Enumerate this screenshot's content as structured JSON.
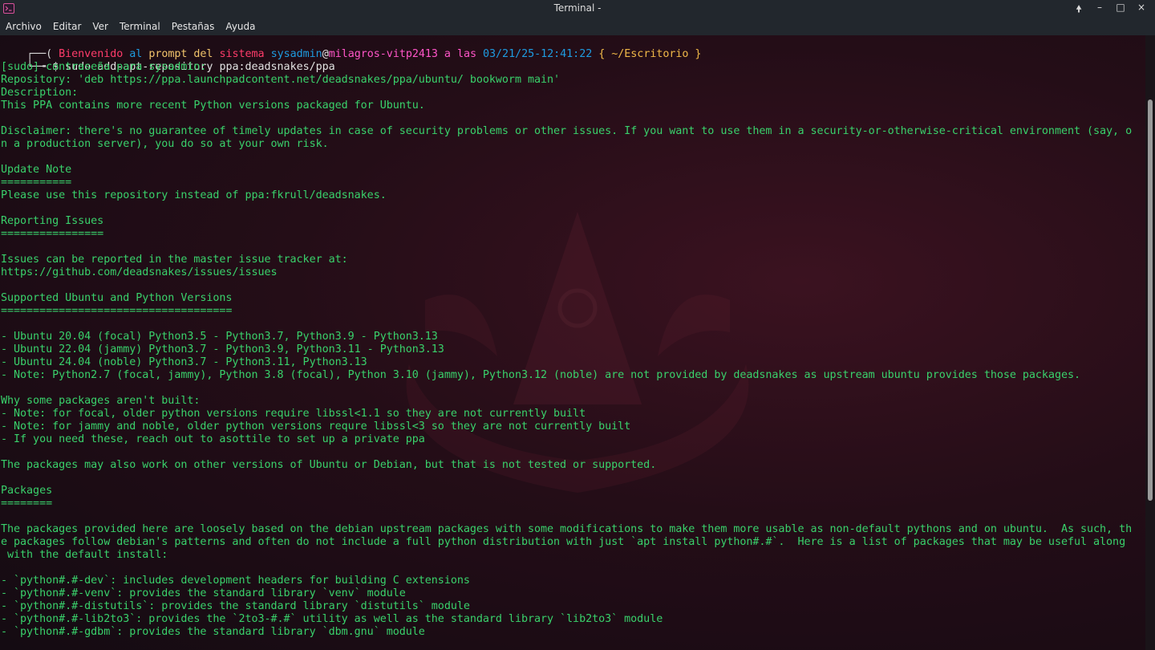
{
  "window": {
    "title": "Terminal -",
    "icon": "terminal-icon",
    "controls": {
      "keep_above": "🠝",
      "minimize": "–",
      "maximize": "□",
      "close": "×"
    }
  },
  "menu": [
    "Archivo",
    "Editar",
    "Ver",
    "Terminal",
    "Pestañas",
    "Ayuda"
  ],
  "prompt": {
    "box_top": "┌──( ",
    "box_bottom": "└─╼ ",
    "w1": "Bienvenido",
    "w2": "al",
    "w3": "prompt",
    "w4": "del",
    "w5": "sistema",
    "user": "sysadmin",
    "at": "@",
    "host": "milagros-vitp2413",
    "w6": "a",
    "w7": "las",
    "date": "03/21/25-12:41:22",
    "path": "{ ~/Escritorio }",
    "dollar": "$ ",
    "command": "sudo add-apt-repository ppa:deadsnakes/ppa"
  },
  "lines": [
    "[sudo] contraseña para sysadmin:",
    "Repository: 'deb https://ppa.launchpadcontent.net/deadsnakes/ppa/ubuntu/ bookworm main'",
    "Description:",
    "This PPA contains more recent Python versions packaged for Ubuntu.",
    "",
    "Disclaimer: there's no guarantee of timely updates in case of security problems or other issues. If you want to use them in a security-or-otherwise-critical environment (say, o",
    "n a production server), you do so at your own risk.",
    "",
    "Update Note",
    "===========",
    "Please use this repository instead of ppa:fkrull/deadsnakes.",
    "",
    "Reporting Issues",
    "================",
    "",
    "Issues can be reported in the master issue tracker at:",
    "https://github.com/deadsnakes/issues/issues",
    "",
    "Supported Ubuntu and Python Versions",
    "====================================",
    "",
    "- Ubuntu 20.04 (focal) Python3.5 - Python3.7, Python3.9 - Python3.13",
    "- Ubuntu 22.04 (jammy) Python3.7 - Python3.9, Python3.11 - Python3.13",
    "- Ubuntu 24.04 (noble) Python3.7 - Python3.11, Python3.13",
    "- Note: Python2.7 (focal, jammy), Python 3.8 (focal), Python 3.10 (jammy), Python3.12 (noble) are not provided by deadsnakes as upstream ubuntu provides those packages.",
    "",
    "Why some packages aren't built:",
    "- Note: for focal, older python versions require libssl<1.1 so they are not currently built",
    "- Note: for jammy and noble, older python versions requre libssl<3 so they are not currently built",
    "- If you need these, reach out to asottile to set up a private ppa",
    "",
    "The packages may also work on other versions of Ubuntu or Debian, but that is not tested or supported.",
    "",
    "Packages",
    "========",
    "",
    "The packages provided here are loosely based on the debian upstream packages with some modifications to make them more usable as non-default pythons and on ubuntu.  As such, th",
    "e packages follow debian's patterns and often do not include a full python distribution with just `apt install python#.#`.  Here is a list of packages that may be useful along",
    " with the default install:",
    "",
    "- `python#.#-dev`: includes development headers for building C extensions",
    "- `python#.#-venv`: provides the standard library `venv` module",
    "- `python#.#-distutils`: provides the standard library `distutils` module",
    "- `python#.#-lib2to3`: provides the `2to3-#.#` utility as well as the standard library `lib2to3` module",
    "- `python#.#-gdbm`: provides the standard library `dbm.gnu` module"
  ]
}
